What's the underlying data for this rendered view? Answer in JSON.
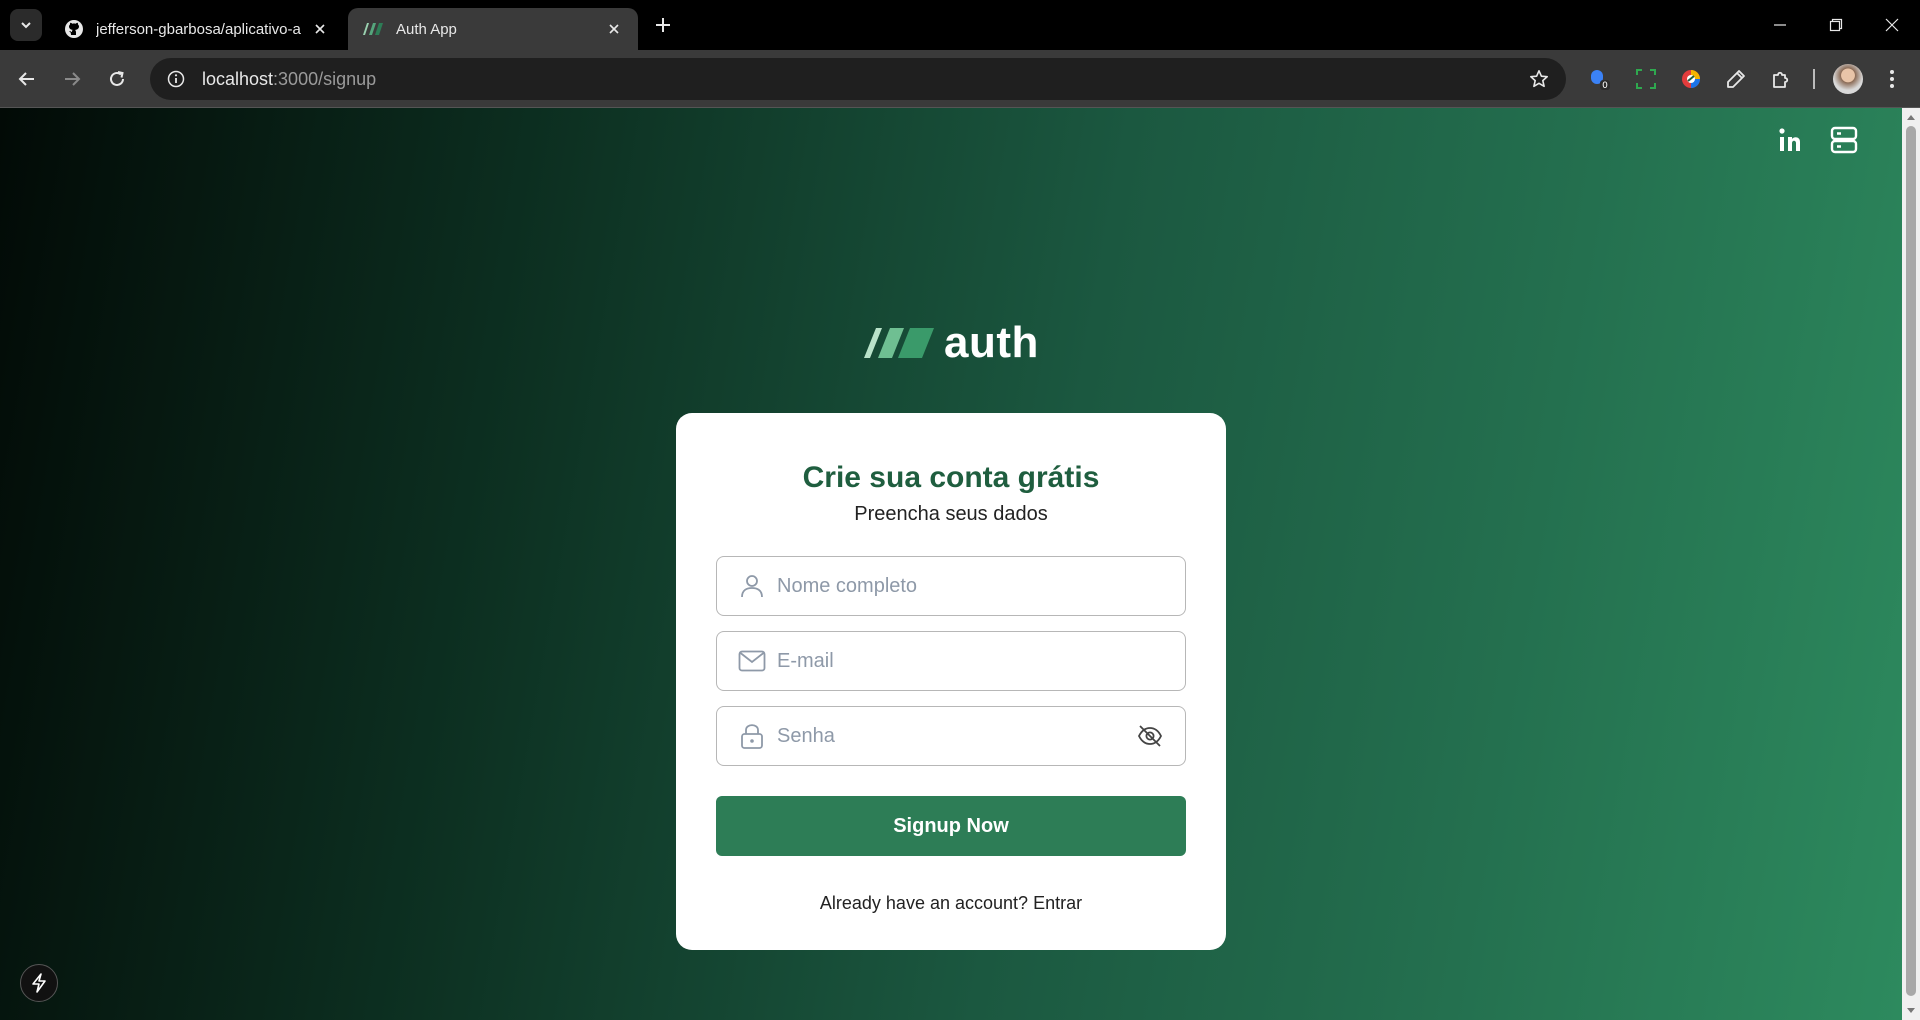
{
  "browser": {
    "tabs": [
      {
        "title": "jefferson-gbarbosa/aplicativo-a",
        "icon": "github-icon",
        "active": false
      },
      {
        "title": "Auth App",
        "icon": "auth-logo-icon",
        "active": true
      }
    ],
    "url_host": "localhost",
    "url_path": ":3000/signup"
  },
  "page": {
    "brand": "auth",
    "title": "Crie sua conta grátis",
    "subtitle": "Preencha seus dados",
    "fields": {
      "name_placeholder": "Nome completo",
      "email_placeholder": "E-mail",
      "password_placeholder": "Senha"
    },
    "submit_label": "Signup Now",
    "login_prompt": "Already have an account?",
    "login_link": "Entrar",
    "top_icons": [
      "linkedin-icon",
      "portfolio-icon"
    ]
  },
  "colors": {
    "accent": "#2d7d56",
    "title": "#1f5e3f",
    "gradient_dark": "#020a06",
    "gradient_light": "#2d8a5e"
  }
}
